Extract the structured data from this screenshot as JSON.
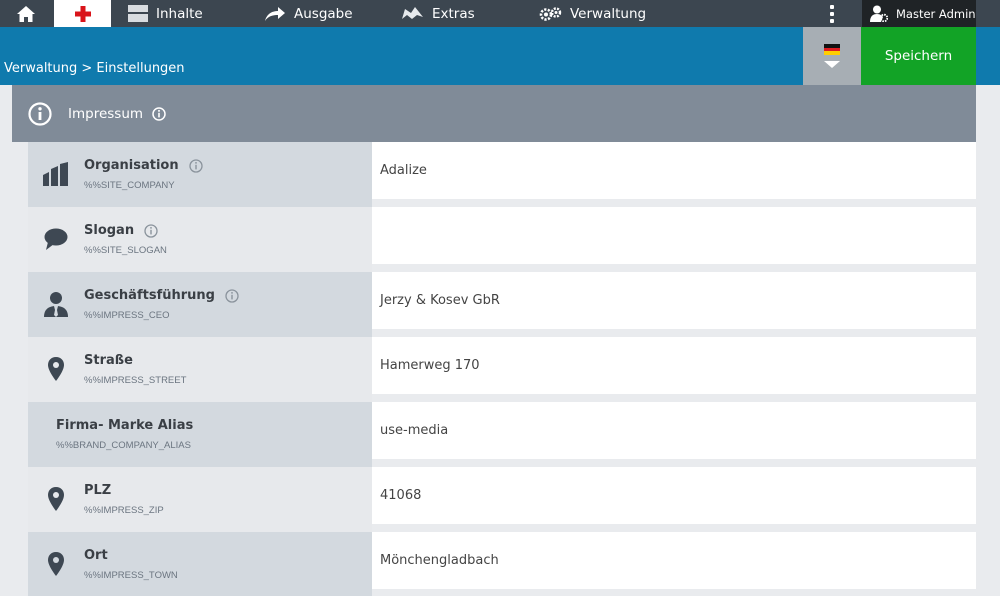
{
  "topbar": {
    "nav": [
      {
        "label": "Inhalte",
        "icon": "content-icon"
      },
      {
        "label": "Ausgabe",
        "icon": "share-arrow-icon"
      },
      {
        "label": "Extras",
        "icon": "extras-icon"
      },
      {
        "label": "Verwaltung",
        "icon": "gears-icon"
      }
    ],
    "user": "Master Admin"
  },
  "breadcrumb": "Verwaltung > Einstellungen",
  "language": "de",
  "save_label": "Speichern",
  "section": {
    "title": "Impressum"
  },
  "rows": [
    {
      "label": "Organisation",
      "key": "%%SITE_COMPANY",
      "value": "Adalize",
      "icon": "building-icon",
      "info": true
    },
    {
      "label": "Slogan",
      "key": "%%SITE_SLOGAN",
      "value": "",
      "icon": "speech-bubble-icon",
      "info": true
    },
    {
      "label": "Geschäftsführung",
      "key": "%%IMPRESS_CEO",
      "value": "Jerzy & Kosev GbR",
      "icon": "person-icon",
      "info": true
    },
    {
      "label": "Straße",
      "key": "%%IMPRESS_STREET",
      "value": "Hamerweg 170",
      "icon": "map-pin-icon",
      "info": false
    },
    {
      "label": "Firma- Marke Alias",
      "key": "%%BRAND_COMPANY_ALIAS",
      "value": "use-media",
      "icon": "",
      "info": false
    },
    {
      "label": "PLZ",
      "key": "%%IMPRESS_ZIP",
      "value": "41068",
      "icon": "map-pin-icon",
      "info": false
    },
    {
      "label": "Ort",
      "key": "%%IMPRESS_TOWN",
      "value": "Mönchengladbach",
      "icon": "map-pin-icon",
      "info": false
    }
  ]
}
